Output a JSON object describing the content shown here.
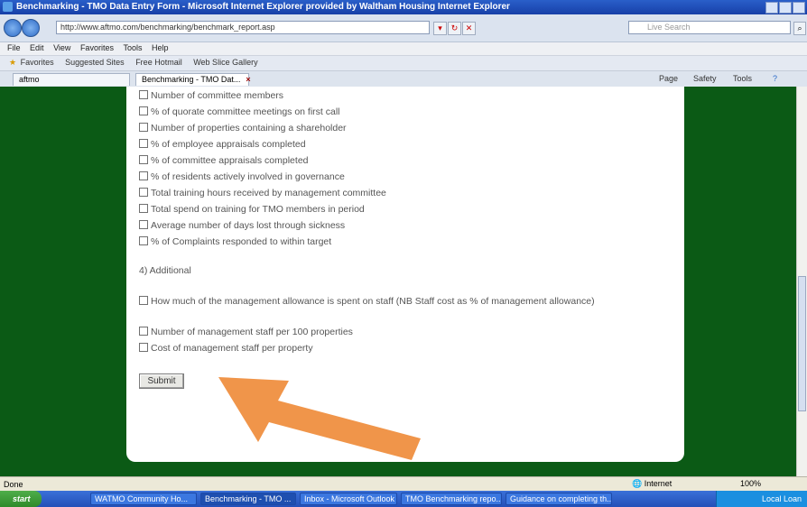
{
  "window": {
    "title": "Benchmarking - TMO Data Entry Form - Microsoft Internet Explorer provided by Waltham Housing Internet Explorer"
  },
  "address": {
    "url": "http://www.aftmo.com/benchmarking/benchmark_report.asp",
    "search_placeholder": "Live Search"
  },
  "menu": [
    "File",
    "Edit",
    "View",
    "Favorites",
    "Tools",
    "Help"
  ],
  "favorites": {
    "label": "Favorites",
    "items": [
      "Suggested Sites",
      "Free Hotmail",
      "Web Slice Gallery"
    ]
  },
  "tabs": {
    "tab1": "aftmo",
    "tab2": "Benchmarking - TMO Dat..."
  },
  "command_bar": [
    "Page",
    "Safety",
    "Tools"
  ],
  "form": {
    "options": [
      "Number of committee members",
      "% of quorate committee meetings on first call",
      "Number of properties containing a shareholder",
      "% of employee appraisals completed",
      "% of committee appraisals completed",
      "% of residents actively involved in governance",
      "Total training hours received by management committee",
      "Total spend on training for TMO members in period",
      "Average number of days lost through sickness",
      "% of Complaints responded to within target"
    ],
    "section_heading": "4) Additional",
    "additional_options": [
      "How much of the management allowance is spent on staff (NB Staff cost as % of management allowance)",
      "Number of management staff per 100 properties",
      "Cost of management staff per property"
    ],
    "submit_label": "Submit"
  },
  "status": {
    "text": "Done",
    "zone": "Internet",
    "zoom": "100%"
  },
  "taskbar": {
    "start_label": "start",
    "tasks": [
      "WATMO Community Ho...",
      "Benchmarking - TMO ...",
      "Inbox - Microsoft Outlook",
      "TMO Benchmarking repo...",
      "Guidance on completing th..."
    ],
    "clock": "Local Loan"
  },
  "colors": {
    "page_background": "#0b5a15",
    "arrow": "#f0954a"
  }
}
